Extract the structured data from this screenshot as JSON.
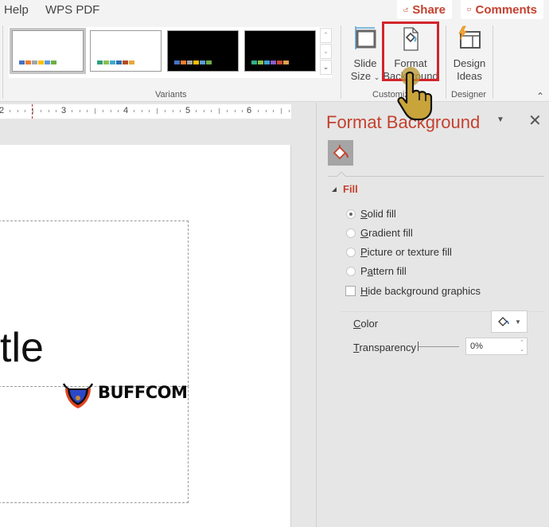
{
  "menubar": {
    "items": [
      "Help",
      "WPS PDF"
    ],
    "share_label": "Share",
    "comments_label": "Comments",
    "accent": "#c4412f"
  },
  "ribbon": {
    "variants_group_label": "Variants",
    "customize_group_label": "Customize",
    "customize_group_label_visible": "Custo",
    "designer_group_label": "Designer",
    "variants": [
      {
        "name": "variant-1",
        "background": "#ffffff",
        "selected": true,
        "swatches": [
          "#4472c4",
          "#ed7d31",
          "#a5a5a5",
          "#ffc000",
          "#5b9bd5",
          "#70ad47"
        ]
      },
      {
        "name": "variant-2",
        "background": "#ffffff",
        "selected": false,
        "swatches": [
          "#2e9e7f",
          "#8cc04f",
          "#3fa8d2",
          "#2a6fad",
          "#b44a25",
          "#e8a73a"
        ]
      },
      {
        "name": "variant-3",
        "background": "#000000",
        "selected": false,
        "swatches": [
          "#4472c4",
          "#ed7d31",
          "#a5a5a5",
          "#ffc000",
          "#5b9bd5",
          "#70ad47"
        ]
      },
      {
        "name": "variant-4",
        "background": "#000000",
        "selected": false,
        "swatches": [
          "#2fb08a",
          "#8cc04f",
          "#3fa0d2",
          "#8a5cc7",
          "#c94a35",
          "#e0a050"
        ]
      }
    ],
    "slide_size_line1": "Slide",
    "slide_size_line2": "Size",
    "format_background_line1": "Format",
    "format_background_line2": "Background",
    "design_ideas_line1": "Design",
    "design_ideas_line2": "Ideas",
    "highlight_color": "#d2242c"
  },
  "ruler": {
    "labels": [
      "2",
      "3",
      "4",
      "5",
      "6"
    ]
  },
  "slide": {
    "title_fragment": "tle",
    "logo_text": "BUFFCOM"
  },
  "pane": {
    "title": "Format Background",
    "section_label": "Fill",
    "options": [
      {
        "pre": "",
        "u": "S",
        "post": "olid fill",
        "checked": true
      },
      {
        "pre": "",
        "u": "G",
        "post": "radient fill",
        "checked": false
      },
      {
        "pre": "",
        "u": "P",
        "post": "icture or texture fill",
        "checked": false
      },
      {
        "pre": "P",
        "u": "a",
        "post": "ttern fill",
        "checked": false
      }
    ],
    "hide_graphics": {
      "u": "H",
      "post": "ide background graphics",
      "checked": false
    },
    "color_label_u": "C",
    "color_label_rest": "olor",
    "transparency_label_u": "T",
    "transparency_label_rest": "ransparency",
    "transparency_value": "0%",
    "transparency_percent": 0
  }
}
